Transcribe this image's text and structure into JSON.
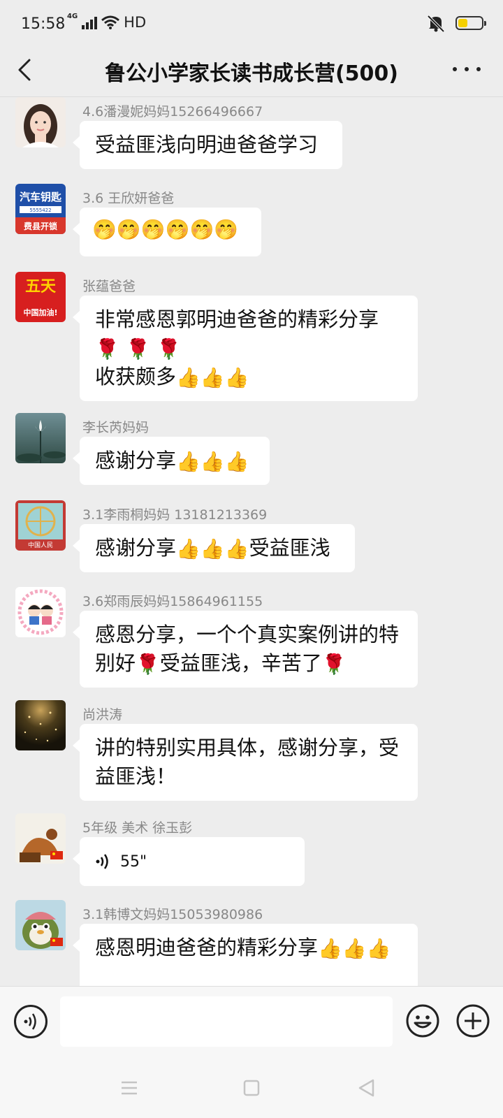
{
  "status_bar": {
    "time": "15:58",
    "network": "4G",
    "hd": "HD",
    "battery_level": 0.4,
    "battery_color": "#f5d000"
  },
  "header": {
    "title": "鲁公小学家长读书成长营(500)",
    "back_icon": "chevron-left-icon",
    "more_icon": "more-dots-icon"
  },
  "messages": [
    {
      "sender": "4.6潘漫妮妈妈15266496667",
      "lines": [
        "受益匪浅向明迪爸爸学习"
      ]
    },
    {
      "sender": "3.6 王欣妍爸爸",
      "emoji": [
        "🤭",
        "🤭",
        "🤭",
        "🤭",
        "🤭",
        "🤭"
      ]
    },
    {
      "sender": "张蕴爸爸",
      "line1": "非常感恩郭明迪爸爸的精彩分享",
      "roses": [
        "🌹",
        "🌹",
        "🌹"
      ],
      "line3_text": "收获颇多",
      "thumbs": [
        "👍",
        "👍",
        "👍"
      ]
    },
    {
      "sender": "李长芮妈妈",
      "text": "感谢分享",
      "thumbs": [
        "👍",
        "👍",
        "👍"
      ]
    },
    {
      "sender": "3.1李雨桐妈妈 13181213369",
      "text_before": "感谢分享",
      "thumbs": [
        "👍",
        "👍",
        "👍"
      ],
      "text_after": "受益匪浅"
    },
    {
      "sender": "3.6郑雨辰妈妈15864961155",
      "line1": "感恩分享，一个个真实案例讲的特",
      "line2_a": "别好",
      "rose1": "🌹",
      "line2_b": "受益匪浅，辛苦了",
      "rose2": "🌹"
    },
    {
      "sender": "尚洪涛",
      "lines": [
        "讲的特别实用具体，感谢分享，受",
        "益匪浅！"
      ]
    },
    {
      "sender": "5年级 美术 徐玉彭",
      "voice_duration": "55\"",
      "voice_icon": "voice-wave-icon"
    },
    {
      "sender": "3.1韩博文妈妈15053980986",
      "text": "感恩明迪爸爸的精彩分享",
      "thumbs": [
        "👍",
        "👍",
        "👍"
      ]
    }
  ],
  "avatar_texts": {
    "car_key_line1": "汽车钥匙",
    "car_key_phone": "5555422",
    "car_key_line2": "费县开锁",
    "wutian_line1": "五天",
    "wutian_line2": "中国加油!",
    "ferris_label": "中国人民"
  },
  "input_bar": {
    "value": "",
    "voice_icon": "voice-toggle-icon",
    "emoji_icon": "emoji-face-icon",
    "plus_icon": "plus-circle-icon"
  },
  "system_nav": {
    "menu_icon": "menu-lines-icon",
    "home_icon": "home-square-icon",
    "back_icon": "back-triangle-icon"
  }
}
